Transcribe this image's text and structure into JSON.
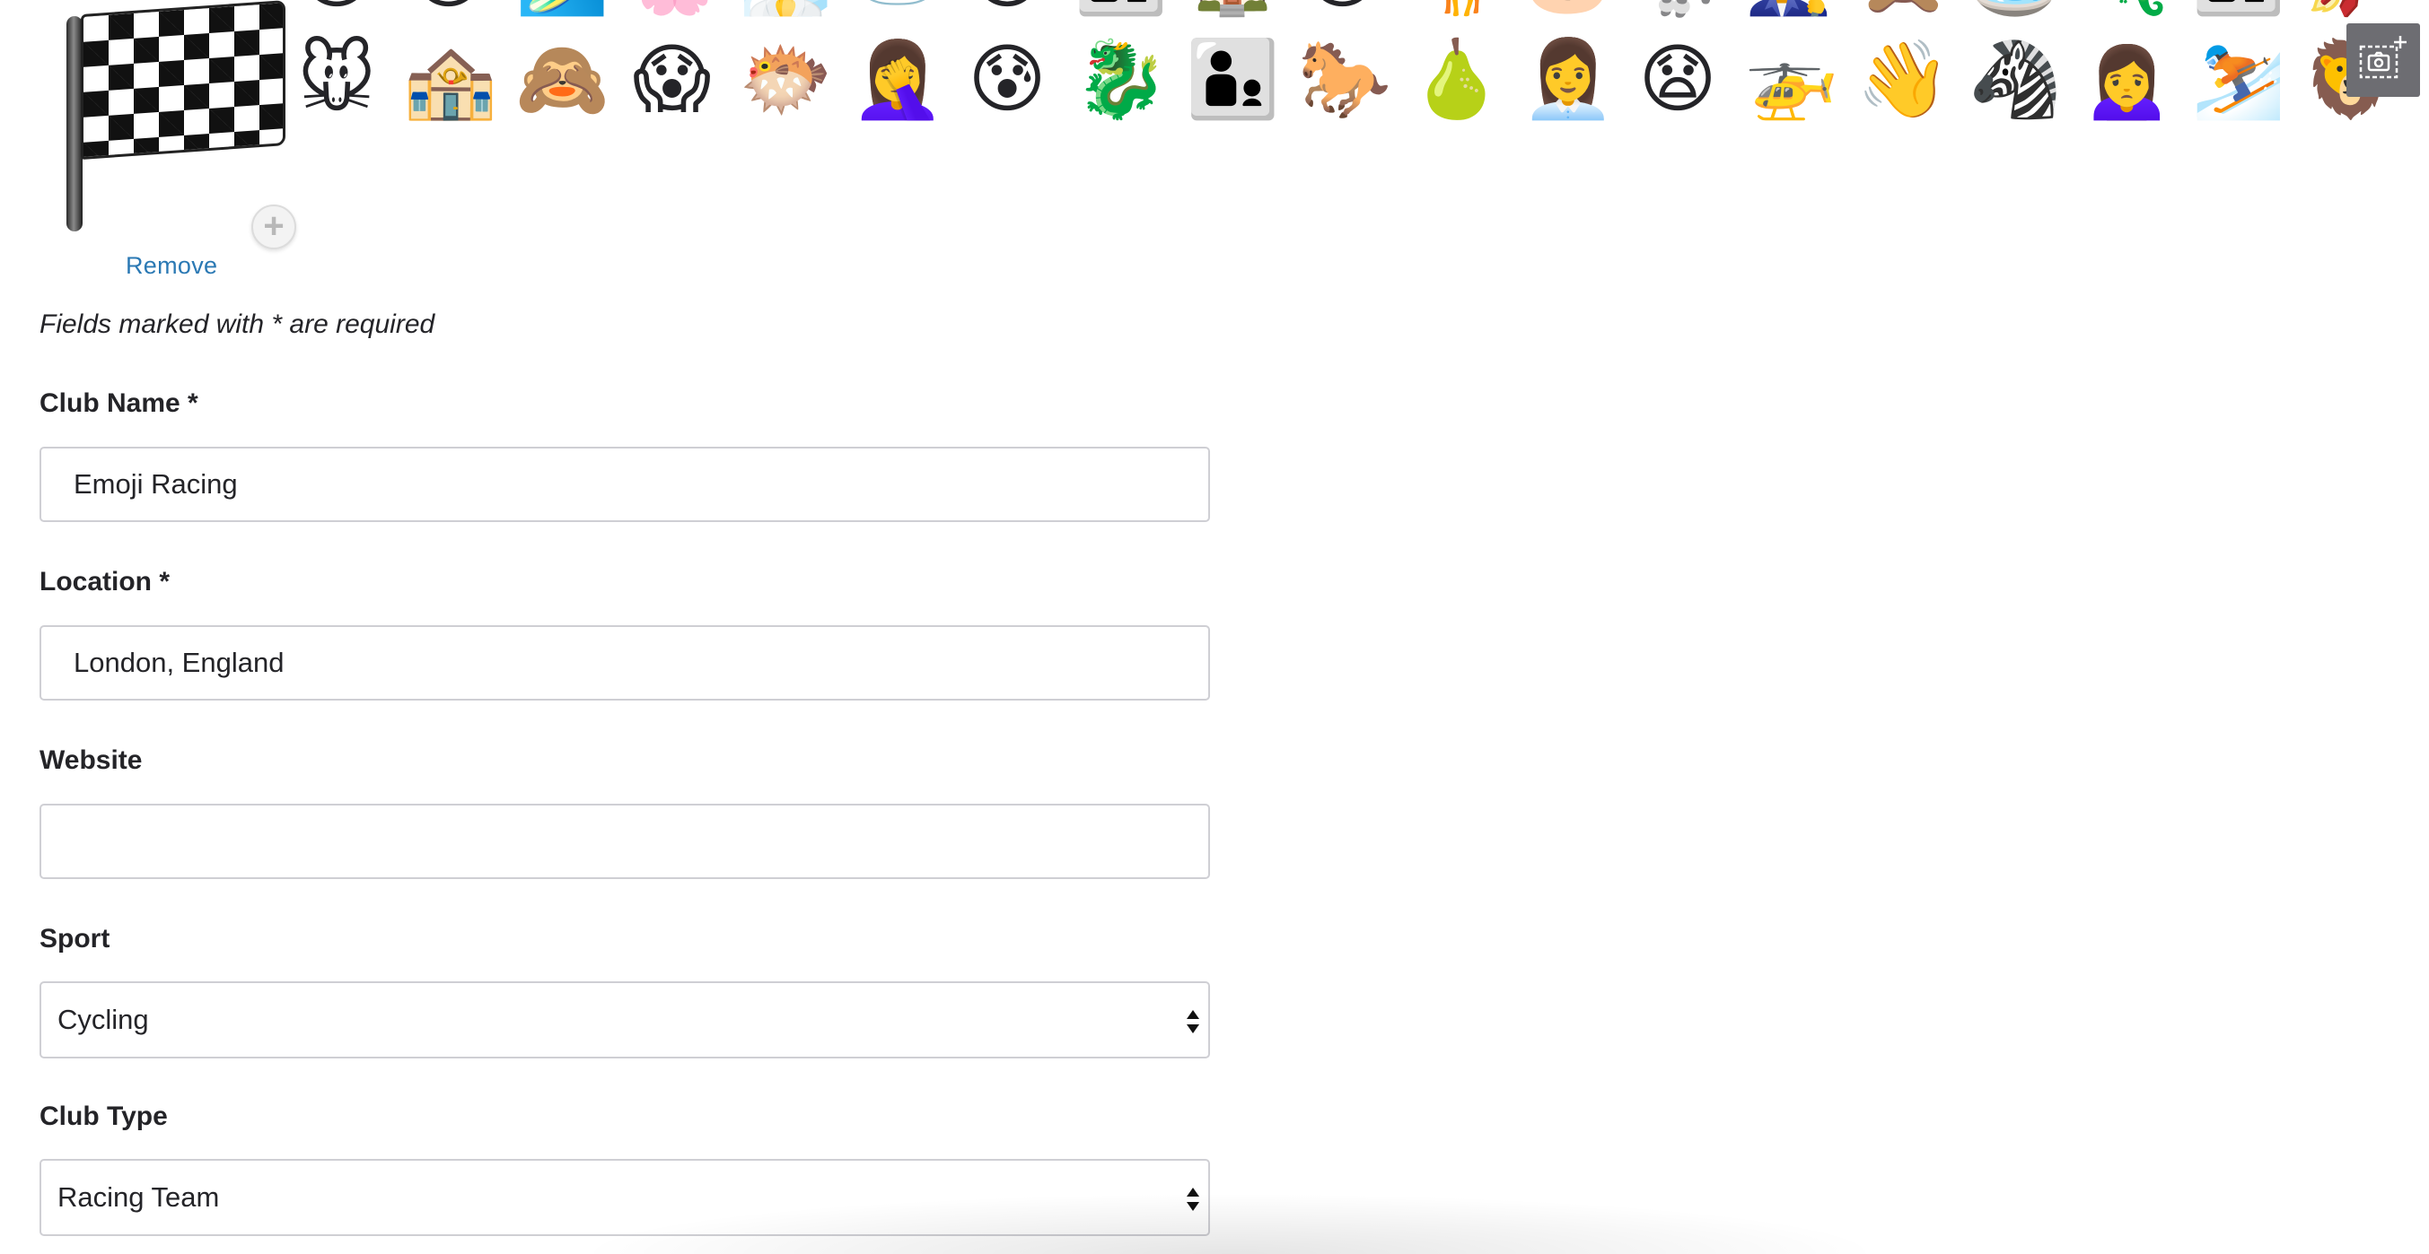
{
  "cover": {
    "top_row_emojis": [
      "😮",
      "😇",
      "🏄",
      "🌸",
      "🧖",
      "🐻‍❄️",
      "😺",
      "👩‍👧",
      "🏠",
      "😫",
      "🦒",
      "🐷",
      "🐩",
      "👨‍🔧",
      "🙊",
      "⛲",
      "🦎",
      "👩‍👧",
      "🚀"
    ],
    "main_row_emojis": [
      "🐭",
      "🏤",
      "🙈",
      "😱",
      "🐡",
      "🤦‍♀️",
      "😰",
      "🐉",
      "👨‍👦",
      "🐎",
      "🍐",
      "👩‍💼",
      "😧",
      "🚁",
      "👋",
      "🦓",
      "🙍‍♀️",
      "⛷️",
      "🦁"
    ]
  },
  "avatar": {
    "icon": "chequered-flag",
    "add_icon": "plus-icon",
    "add_symbol": "+",
    "remove_label": "Remove"
  },
  "screenshot_tool": {
    "icon": "add-screenshot-icon"
  },
  "form": {
    "required_note": "Fields marked with * are required",
    "club_name": {
      "label": "Club Name *",
      "value": ""
    },
    "location": {
      "label": "Location *",
      "value": "London, England"
    },
    "website": {
      "label": "Website",
      "value": ""
    },
    "sport": {
      "label": "Sport",
      "selected": "Cycling"
    },
    "club_type": {
      "label": "Club Type",
      "selected": "Racing Team"
    }
  },
  "form_values": {
    "club_name": "Emoji Racing"
  }
}
